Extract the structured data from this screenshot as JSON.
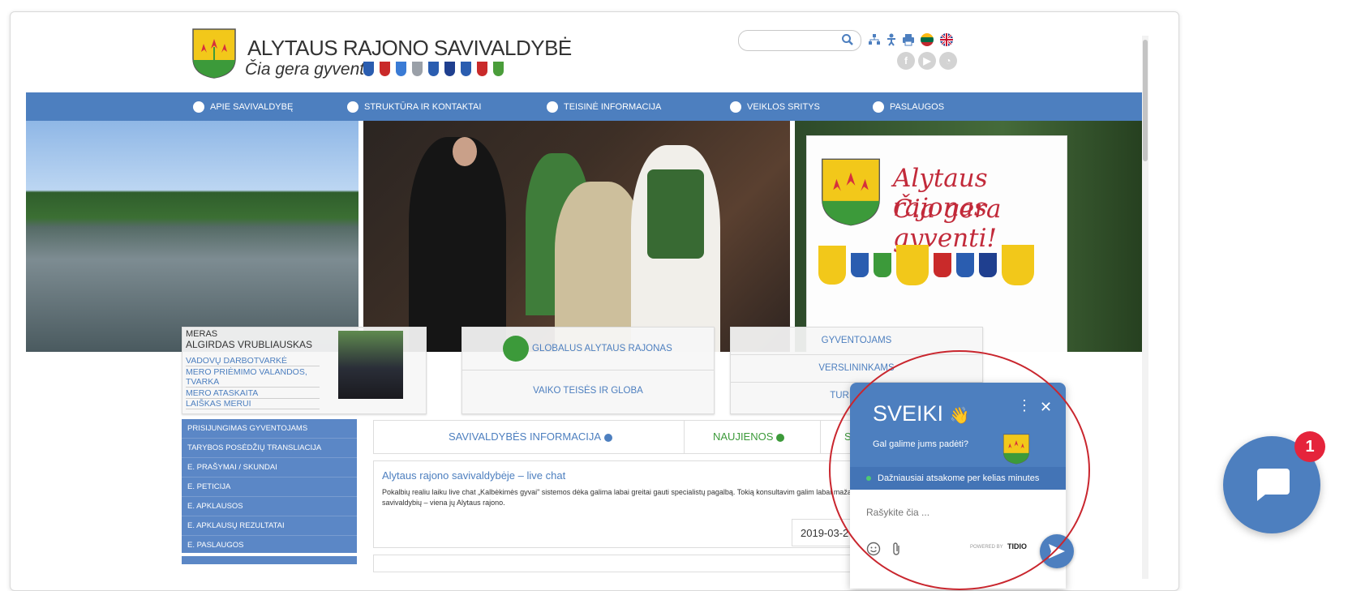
{
  "site": {
    "title": "ALYTAUS RAJONO SAVIVALDYBĖ",
    "slogan": "Čia gera gyventi!",
    "shield_colors": [
      "#2a5db0",
      "#c92a2a",
      "#3a7bd5",
      "#9aa0a8",
      "#2a5db0",
      "#1f3f8f",
      "#2a5db0",
      "#c92a2a",
      "#4a9d3a"
    ]
  },
  "search": {
    "placeholder": ""
  },
  "nav": {
    "items": [
      {
        "label": "APIE SAVIVALDYBĘ"
      },
      {
        "label": "STRUKTŪRA IR KONTAKTAI"
      },
      {
        "label": "TEISINĖ INFORMACIJA"
      },
      {
        "label": "VEIKLOS SRITYS"
      },
      {
        "label": "PASLAUGOS"
      }
    ]
  },
  "banner": {
    "poster_line1": "Alytaus rajonas",
    "poster_line2": "Čia gera gyventi!"
  },
  "mayor": {
    "role": "MERAS",
    "name": "ALGIRDAS VRUBLIAUSKAS",
    "links": [
      "VADOVŲ DARBOTVARKĖ",
      "MERO PRIĖMIMO VALANDOS, TVARKA",
      "MERO ATASKAITA",
      "LAIŠKAS MERUI"
    ]
  },
  "center_box": {
    "global": "GLOBALUS ALYTAUS RAJONAS",
    "child": "VAIKO TEISĖS IR GLOBA"
  },
  "right_box": {
    "items": [
      "GYVENTOJAMS",
      "VERSLININKAMS",
      "TURISTAMS"
    ]
  },
  "sidebar": {
    "items": [
      "PRISIJUNGIMAS GYVENTOJAMS",
      "TARYBOS POSĖDŽIŲ TRANSLIACIJA",
      "E. PRAŠYMAI / SKUNDAI",
      "E. PETICIJA",
      "E. APKLAUSOS",
      "E. APKLAUSŲ REZULTATAI",
      "E. PASLAUGOS"
    ]
  },
  "tabs": {
    "info": "SAVIVALDYBĖS INFORMACIJA",
    "news": "NAUJIENOS",
    "third": "SK"
  },
  "news": {
    "title": "Alytaus rajono savivaldybėje – live chat",
    "text": "Pokalbių realiu laiku live chat „Kalbėkimės gyvai\" sistemos dėka galima labai greitai gauti specialistų pagalbą. Tokią konsultavim galim labai mažai savivaldybių – viena jų Alytaus rajono.",
    "date": "2019-03-2"
  },
  "chat": {
    "greeting": "SVEIKI",
    "wave": "👋",
    "question": "Gal galime jums padėti?",
    "status": "Dažniausiai atsakome per kelias minutes",
    "input_placeholder": "Rašykite čia ...",
    "powered": "POWERED BY",
    "brand": "TIDIO",
    "menu": "⋮",
    "close": "✕"
  },
  "launcher": {
    "badge": "1"
  },
  "colors": {
    "primary": "#4d7fbf",
    "badge": "#e5243b",
    "annotation": "#c9262e"
  }
}
